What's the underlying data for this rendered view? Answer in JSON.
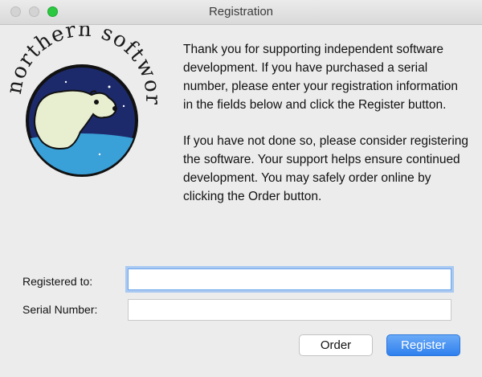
{
  "window": {
    "title": "Registration",
    "traffic_lights": [
      "close",
      "minimize",
      "zoom"
    ]
  },
  "logo": {
    "text_top": "northern softworks",
    "icon": "polar-bear-logo"
  },
  "message": {
    "paragraph1": "Thank you for supporting independent software development.  If you have purchased a serial number, please enter your registration information in the fields below and click the Register button.",
    "paragraph2": "If you have not done so, please consider registering the software.  Your support helps ensure continued development.  You may safely order online by clicking the Order button."
  },
  "form": {
    "registered_to_label": "Registered to:",
    "registered_to_value": "",
    "serial_number_label": "Serial Number:",
    "serial_number_value": ""
  },
  "buttons": {
    "order_label": "Order",
    "register_label": "Register"
  },
  "colors": {
    "accent": "#2f80ee",
    "focus_ring": "#a9c9f2"
  }
}
